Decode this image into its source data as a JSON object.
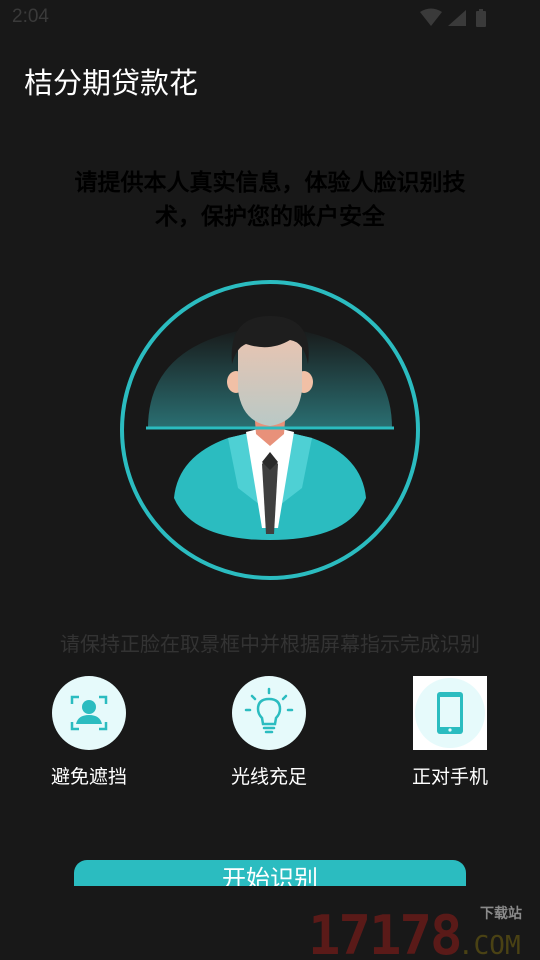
{
  "status_bar": {
    "time": "2:04",
    "icons": [
      "wifi-icon",
      "signal-icon",
      "battery-icon"
    ]
  },
  "app": {
    "title": "桔分期贷款花"
  },
  "headline": "请提供本人真实信息，体验人脸识别技术，保护您的账户安全",
  "instruction": "请保持正脸在取景框中并根据屏幕指示完成识别",
  "tips": [
    {
      "label": "避免遮挡",
      "icon": "face-scan-icon"
    },
    {
      "label": "光线充足",
      "icon": "lightbulb-icon"
    },
    {
      "label": "正对手机",
      "icon": "phone-icon"
    }
  ],
  "start_button": {
    "label": "开始识别"
  },
  "watermark": {
    "number": "17178",
    "domain": ".COM",
    "tag": "下载站"
  },
  "colors": {
    "background": "#181818",
    "accent": "#2bbcc0",
    "tip_circle": "#e6fafb"
  }
}
